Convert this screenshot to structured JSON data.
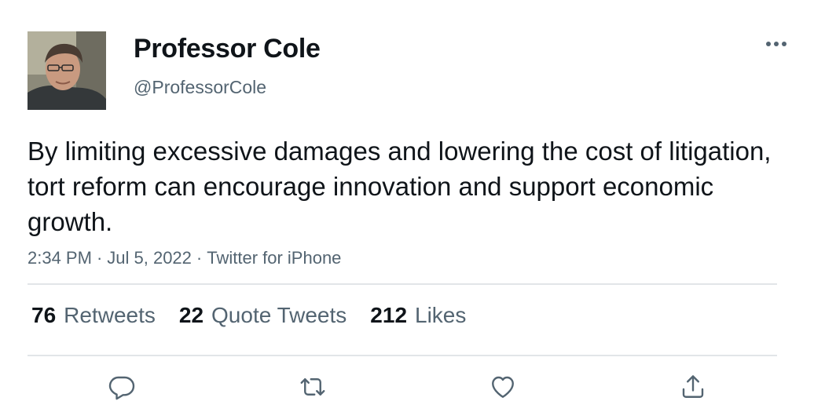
{
  "author": {
    "display_name": "Professor Cole",
    "handle": "@ProfessorCole",
    "avatar_icon": "profile-photo"
  },
  "tweet": {
    "text": "By limiting excessive damages and lowering the cost of litigation, tort reform can encourage innovation and support economic growth.",
    "time": "2:34 PM",
    "date": "Jul 5, 2022",
    "source": "Twitter for iPhone",
    "separator": "·"
  },
  "stats": {
    "retweets_count": "76",
    "retweets_label": "Retweets",
    "quotes_count": "22",
    "quotes_label": "Quote Tweets",
    "likes_count": "212",
    "likes_label": "Likes"
  },
  "actions": {
    "reply_icon": "reply-icon",
    "retweet_icon": "retweet-icon",
    "like_icon": "heart-icon",
    "share_icon": "share-icon",
    "more_icon": "more-icon"
  },
  "colors": {
    "text_primary": "#0f1419",
    "text_secondary": "#536471",
    "divider": "#e2e5e8",
    "icon": "#536471"
  }
}
